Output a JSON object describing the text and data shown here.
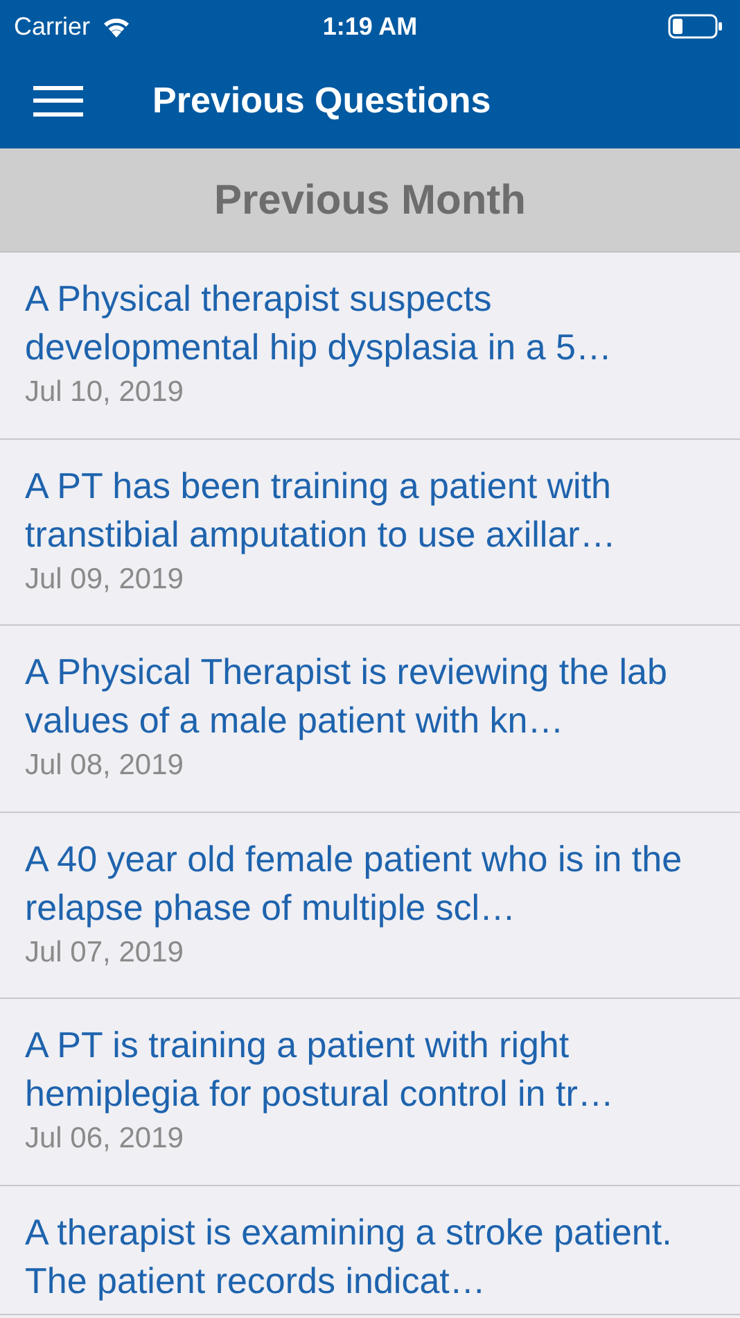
{
  "status_bar": {
    "carrier": "Carrier",
    "time": "1:19 AM"
  },
  "header": {
    "title": "Previous Questions"
  },
  "section": {
    "title": "Previous Month"
  },
  "questions": [
    {
      "title": "A Physical therapist suspects developmental hip dysplasia in a 5…",
      "date": "Jul 10, 2019"
    },
    {
      "title": "A PT has been training a patient with transtibial amputation to use axillar…",
      "date": "Jul 09, 2019"
    },
    {
      "title": "A Physical Therapist is reviewing the lab values of a male patient with kn…",
      "date": "Jul 08, 2019"
    },
    {
      "title": "A 40 year old female patient who is in the relapse phase of multiple scl…",
      "date": "Jul 07, 2019"
    },
    {
      "title": "A PT is training a patient with right hemiplegia for postural control in tr…",
      "date": "Jul 06, 2019"
    },
    {
      "title": "A therapist is examining a stroke patient. The patient records indicat…"
    }
  ]
}
